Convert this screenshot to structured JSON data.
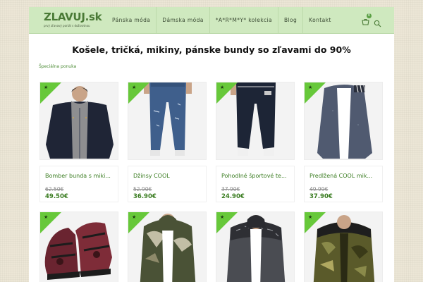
{
  "header": {
    "logo_main": "ZLAVUJ.sk",
    "logo_tagline": "prvý zľavový portál s doživotnou",
    "nav": [
      {
        "label": "Pánska móda"
      },
      {
        "label": "Dámska móda"
      },
      {
        "label": "*A*R*M*Y* kolekcia"
      },
      {
        "label": "Blog"
      },
      {
        "label": "Kontakt"
      }
    ],
    "cart_count": "0",
    "icons": [
      "cart-icon",
      "search-icon"
    ]
  },
  "page": {
    "title": "Košele, tričká, mikiny, pánske bundy so zľavami do 90%",
    "breadcrumb": "Špeciálna ponuka"
  },
  "badge_glyph": "★",
  "products": [
    {
      "name": "Bomber bunda s miki...",
      "old_price": "62.50€",
      "new_price": "49.50€",
      "image": "navy bomber jacket"
    },
    {
      "name": "Džínsy COOL",
      "old_price": "52.90€",
      "new_price": "36.90€",
      "image": "ripped blue jeans"
    },
    {
      "name": "Pohodlné športové te...",
      "old_price": "37.90€",
      "new_price": "24.90€",
      "image": "navy jogger pants"
    },
    {
      "name": "Predĺžená COOL mik...",
      "old_price": "49.99€",
      "new_price": "37.90€",
      "image": "long grey hoodie"
    },
    {
      "name": "",
      "old_price": "",
      "new_price": "",
      "image": "camo red high-top sneakers"
    },
    {
      "name": "",
      "old_price": "",
      "new_price": "",
      "image": "camo longline hoodie"
    },
    {
      "name": "",
      "old_price": "",
      "new_price": "",
      "image": "grey sweatshirt with print"
    },
    {
      "name": "",
      "old_price": "",
      "new_price": "",
      "image": "camo puffer jacket"
    }
  ],
  "colors": {
    "header_bg": "#cfe9bf",
    "accent": "#3b7d22",
    "badge": "#67c83a",
    "page_bg": "#ece6d6"
  }
}
